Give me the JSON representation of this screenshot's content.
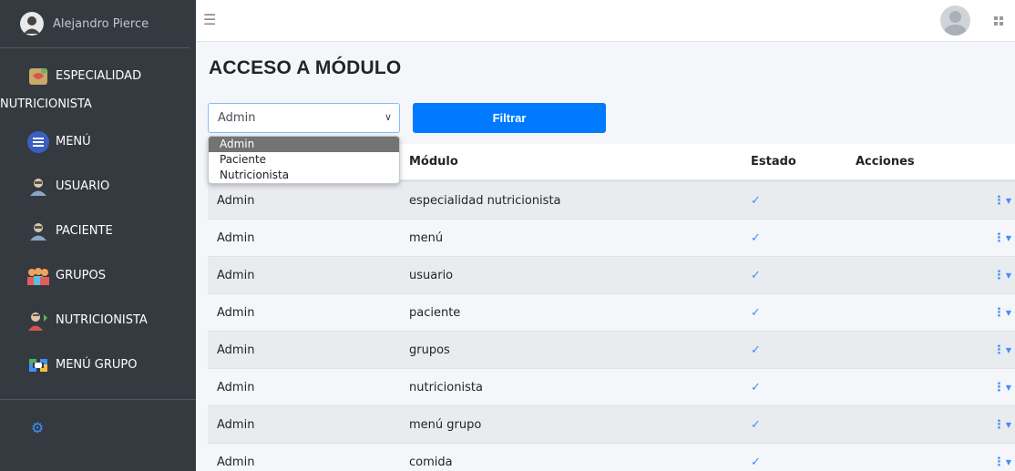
{
  "sidebar": {
    "user_name": "Alejandro Pierce",
    "items": [
      {
        "label_line1": "ESPECIALIDAD",
        "label_line2": "NUTRICIONISTA",
        "icon": "nutrition-icon"
      },
      {
        "label": "MENÚ",
        "icon": "menu-list-icon"
      },
      {
        "label": "USUARIO",
        "icon": "user-icon"
      },
      {
        "label": "PACIENTE",
        "icon": "patient-icon"
      },
      {
        "label": "GRUPOS",
        "icon": "group-icon"
      },
      {
        "label": "NUTRICIONISTA",
        "icon": "nutritionist-icon"
      },
      {
        "label": "MENÚ GRUPO",
        "icon": "group-menu-icon"
      }
    ]
  },
  "page": {
    "title": "ACCESO A MÓDULO"
  },
  "filter": {
    "selected": "Admin",
    "button_label": "Filtrar",
    "options": [
      "Admin",
      "Paciente",
      "Nutricionista"
    ]
  },
  "table": {
    "headers": [
      "Módulo",
      "Estado",
      "Acciones"
    ],
    "rows": [
      {
        "role": "Admin",
        "module": "especialidad nutricionista",
        "estado": "✓"
      },
      {
        "role": "Admin",
        "module": "menú",
        "estado": "✓"
      },
      {
        "role": "Admin",
        "module": "usuario",
        "estado": "✓"
      },
      {
        "role": "Admin",
        "module": "paciente",
        "estado": "✓"
      },
      {
        "role": "Admin",
        "module": "grupos",
        "estado": "✓"
      },
      {
        "role": "Admin",
        "module": "nutricionista",
        "estado": "✓"
      },
      {
        "role": "Admin",
        "module": "menú grupo",
        "estado": "✓"
      },
      {
        "role": "Admin",
        "module": "comida",
        "estado": "✓"
      }
    ]
  },
  "colors": {
    "sidebar_bg": "#343a40",
    "primary": "#007bff",
    "check": "#3f8efc"
  }
}
